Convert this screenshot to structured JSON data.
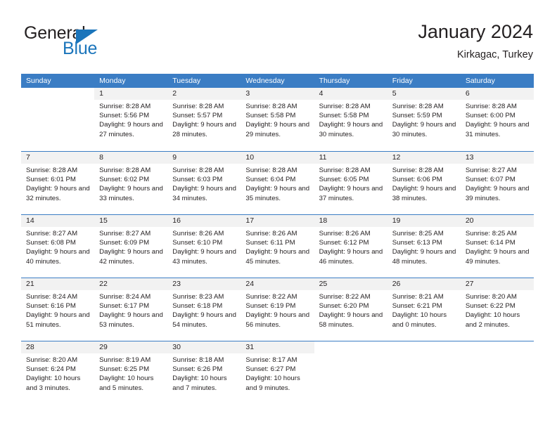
{
  "brand": {
    "name_part1": "General",
    "name_part2": "Blue",
    "triangle_color": "#1b75bb",
    "text_color": "#231f20"
  },
  "header": {
    "title": "January 2024",
    "subtitle": "Kirkagac, Turkey"
  },
  "theme": {
    "header_blue": "#3b7dc4",
    "day_band_gray": "#f2f2f2",
    "text": "#231f20",
    "white": "#ffffff"
  },
  "weekdays": [
    "Sunday",
    "Monday",
    "Tuesday",
    "Wednesday",
    "Thursday",
    "Friday",
    "Saturday"
  ],
  "labels": {
    "sunrise_prefix": "Sunrise:",
    "sunset_prefix": "Sunset:",
    "daylight_prefix": "Daylight:"
  },
  "weeks": [
    [
      {
        "day": "",
        "sunrise": "",
        "sunset": "",
        "daylight": "",
        "empty": true
      },
      {
        "day": "1",
        "sunrise": "Sunrise: 8:28 AM",
        "sunset": "Sunset: 5:56 PM",
        "daylight": "Daylight: 9 hours and 27 minutes."
      },
      {
        "day": "2",
        "sunrise": "Sunrise: 8:28 AM",
        "sunset": "Sunset: 5:57 PM",
        "daylight": "Daylight: 9 hours and 28 minutes."
      },
      {
        "day": "3",
        "sunrise": "Sunrise: 8:28 AM",
        "sunset": "Sunset: 5:58 PM",
        "daylight": "Daylight: 9 hours and 29 minutes."
      },
      {
        "day": "4",
        "sunrise": "Sunrise: 8:28 AM",
        "sunset": "Sunset: 5:58 PM",
        "daylight": "Daylight: 9 hours and 30 minutes."
      },
      {
        "day": "5",
        "sunrise": "Sunrise: 8:28 AM",
        "sunset": "Sunset: 5:59 PM",
        "daylight": "Daylight: 9 hours and 30 minutes."
      },
      {
        "day": "6",
        "sunrise": "Sunrise: 8:28 AM",
        "sunset": "Sunset: 6:00 PM",
        "daylight": "Daylight: 9 hours and 31 minutes."
      }
    ],
    [
      {
        "day": "7",
        "sunrise": "Sunrise: 8:28 AM",
        "sunset": "Sunset: 6:01 PM",
        "daylight": "Daylight: 9 hours and 32 minutes."
      },
      {
        "day": "8",
        "sunrise": "Sunrise: 8:28 AM",
        "sunset": "Sunset: 6:02 PM",
        "daylight": "Daylight: 9 hours and 33 minutes."
      },
      {
        "day": "9",
        "sunrise": "Sunrise: 8:28 AM",
        "sunset": "Sunset: 6:03 PM",
        "daylight": "Daylight: 9 hours and 34 minutes."
      },
      {
        "day": "10",
        "sunrise": "Sunrise: 8:28 AM",
        "sunset": "Sunset: 6:04 PM",
        "daylight": "Daylight: 9 hours and 35 minutes."
      },
      {
        "day": "11",
        "sunrise": "Sunrise: 8:28 AM",
        "sunset": "Sunset: 6:05 PM",
        "daylight": "Daylight: 9 hours and 37 minutes."
      },
      {
        "day": "12",
        "sunrise": "Sunrise: 8:28 AM",
        "sunset": "Sunset: 6:06 PM",
        "daylight": "Daylight: 9 hours and 38 minutes."
      },
      {
        "day": "13",
        "sunrise": "Sunrise: 8:27 AM",
        "sunset": "Sunset: 6:07 PM",
        "daylight": "Daylight: 9 hours and 39 minutes."
      }
    ],
    [
      {
        "day": "14",
        "sunrise": "Sunrise: 8:27 AM",
        "sunset": "Sunset: 6:08 PM",
        "daylight": "Daylight: 9 hours and 40 minutes."
      },
      {
        "day": "15",
        "sunrise": "Sunrise: 8:27 AM",
        "sunset": "Sunset: 6:09 PM",
        "daylight": "Daylight: 9 hours and 42 minutes."
      },
      {
        "day": "16",
        "sunrise": "Sunrise: 8:26 AM",
        "sunset": "Sunset: 6:10 PM",
        "daylight": "Daylight: 9 hours and 43 minutes."
      },
      {
        "day": "17",
        "sunrise": "Sunrise: 8:26 AM",
        "sunset": "Sunset: 6:11 PM",
        "daylight": "Daylight: 9 hours and 45 minutes."
      },
      {
        "day": "18",
        "sunrise": "Sunrise: 8:26 AM",
        "sunset": "Sunset: 6:12 PM",
        "daylight": "Daylight: 9 hours and 46 minutes."
      },
      {
        "day": "19",
        "sunrise": "Sunrise: 8:25 AM",
        "sunset": "Sunset: 6:13 PM",
        "daylight": "Daylight: 9 hours and 48 minutes."
      },
      {
        "day": "20",
        "sunrise": "Sunrise: 8:25 AM",
        "sunset": "Sunset: 6:14 PM",
        "daylight": "Daylight: 9 hours and 49 minutes."
      }
    ],
    [
      {
        "day": "21",
        "sunrise": "Sunrise: 8:24 AM",
        "sunset": "Sunset: 6:16 PM",
        "daylight": "Daylight: 9 hours and 51 minutes."
      },
      {
        "day": "22",
        "sunrise": "Sunrise: 8:24 AM",
        "sunset": "Sunset: 6:17 PM",
        "daylight": "Daylight: 9 hours and 53 minutes."
      },
      {
        "day": "23",
        "sunrise": "Sunrise: 8:23 AM",
        "sunset": "Sunset: 6:18 PM",
        "daylight": "Daylight: 9 hours and 54 minutes."
      },
      {
        "day": "24",
        "sunrise": "Sunrise: 8:22 AM",
        "sunset": "Sunset: 6:19 PM",
        "daylight": "Daylight: 9 hours and 56 minutes."
      },
      {
        "day": "25",
        "sunrise": "Sunrise: 8:22 AM",
        "sunset": "Sunset: 6:20 PM",
        "daylight": "Daylight: 9 hours and 58 minutes."
      },
      {
        "day": "26",
        "sunrise": "Sunrise: 8:21 AM",
        "sunset": "Sunset: 6:21 PM",
        "daylight": "Daylight: 10 hours and 0 minutes."
      },
      {
        "day": "27",
        "sunrise": "Sunrise: 8:20 AM",
        "sunset": "Sunset: 6:22 PM",
        "daylight": "Daylight: 10 hours and 2 minutes."
      }
    ],
    [
      {
        "day": "28",
        "sunrise": "Sunrise: 8:20 AM",
        "sunset": "Sunset: 6:24 PM",
        "daylight": "Daylight: 10 hours and 3 minutes."
      },
      {
        "day": "29",
        "sunrise": "Sunrise: 8:19 AM",
        "sunset": "Sunset: 6:25 PM",
        "daylight": "Daylight: 10 hours and 5 minutes."
      },
      {
        "day": "30",
        "sunrise": "Sunrise: 8:18 AM",
        "sunset": "Sunset: 6:26 PM",
        "daylight": "Daylight: 10 hours and 7 minutes."
      },
      {
        "day": "31",
        "sunrise": "Sunrise: 8:17 AM",
        "sunset": "Sunset: 6:27 PM",
        "daylight": "Daylight: 10 hours and 9 minutes."
      },
      {
        "day": "",
        "sunrise": "",
        "sunset": "",
        "daylight": "",
        "empty": true
      },
      {
        "day": "",
        "sunrise": "",
        "sunset": "",
        "daylight": "",
        "empty": true
      },
      {
        "day": "",
        "sunrise": "",
        "sunset": "",
        "daylight": "",
        "empty": true
      }
    ]
  ]
}
